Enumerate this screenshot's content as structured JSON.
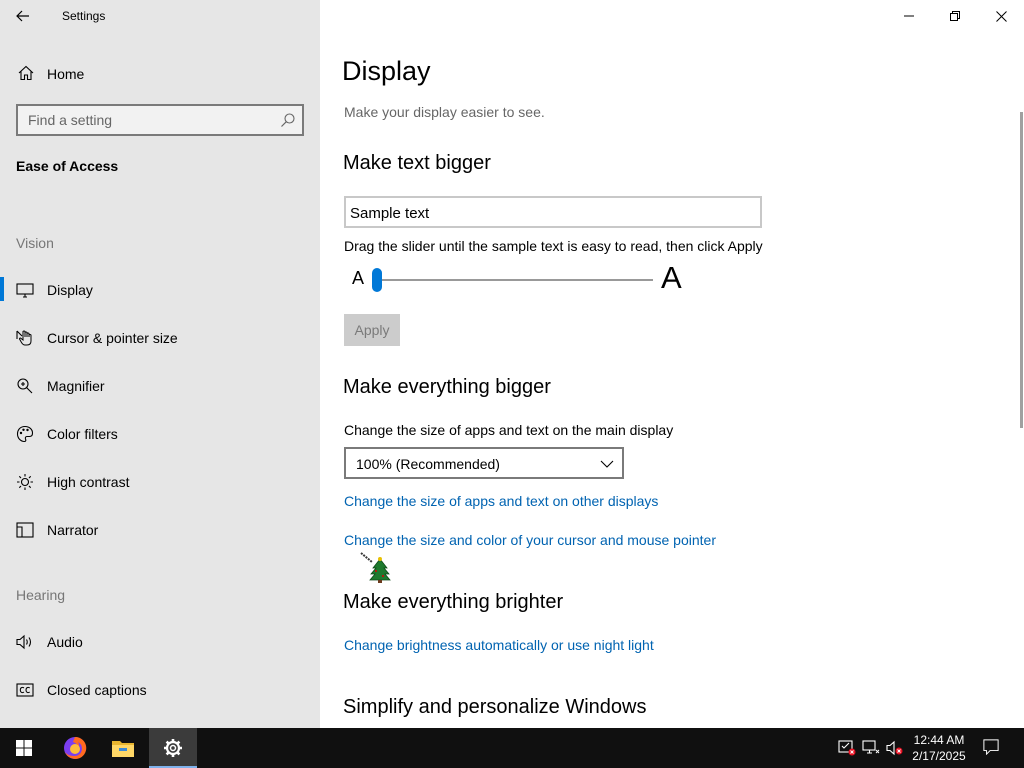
{
  "window": {
    "title": "Settings"
  },
  "sidebar": {
    "home_label": "Home",
    "search_placeholder": "Find a setting",
    "section_title": "Ease of Access",
    "groups": {
      "vision": "Vision",
      "hearing": "Hearing"
    },
    "items": [
      {
        "label": "Display",
        "icon": "monitor-icon",
        "selected": true
      },
      {
        "label": "Cursor & pointer size",
        "icon": "pointer-icon"
      },
      {
        "label": "Magnifier",
        "icon": "magnifier-icon"
      },
      {
        "label": "Color filters",
        "icon": "palette-icon"
      },
      {
        "label": "High contrast",
        "icon": "sun-icon"
      },
      {
        "label": "Narrator",
        "icon": "narrator-icon"
      },
      {
        "label": "Audio",
        "icon": "speaker-icon"
      },
      {
        "label": "Closed captions",
        "icon": "cc-icon"
      }
    ]
  },
  "main": {
    "title": "Display",
    "subtitle": "Make your display easier to see.",
    "text_bigger": {
      "heading": "Make text bigger",
      "sample": "Sample text",
      "hint": "Drag the slider until the sample text is easy to read, then click Apply",
      "small_a": "A",
      "big_a": "A",
      "slider_value": 0,
      "apply_label": "Apply"
    },
    "everything_bigger": {
      "heading": "Make everything bigger",
      "label": "Change the size of apps and text on the main display",
      "dropdown_value": "100% (Recommended)",
      "link_other_displays": "Change the size of apps and text on other displays",
      "link_cursor": "Change the size and color of your cursor and mouse pointer"
    },
    "brighter": {
      "heading": "Make everything brighter",
      "link": "Change brightness automatically or use night light"
    },
    "simplify": {
      "heading": "Simplify and personalize Windows"
    }
  },
  "taskbar": {
    "time": "12:44 AM",
    "date": "2/17/2025",
    "apps": [
      "start-icon",
      "firefox-icon",
      "file-explorer-icon",
      "settings-icon"
    ],
    "accent": "#0078d7"
  }
}
